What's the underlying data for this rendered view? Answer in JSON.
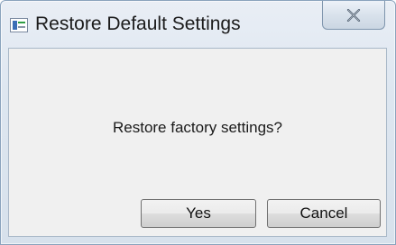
{
  "window": {
    "title": "Restore Default Settings",
    "close_icon": "close-icon",
    "app_icon": "settings-window-icon"
  },
  "dialog": {
    "message": "Restore factory settings?",
    "buttons": {
      "yes_label": "Yes",
      "cancel_label": "Cancel"
    }
  }
}
